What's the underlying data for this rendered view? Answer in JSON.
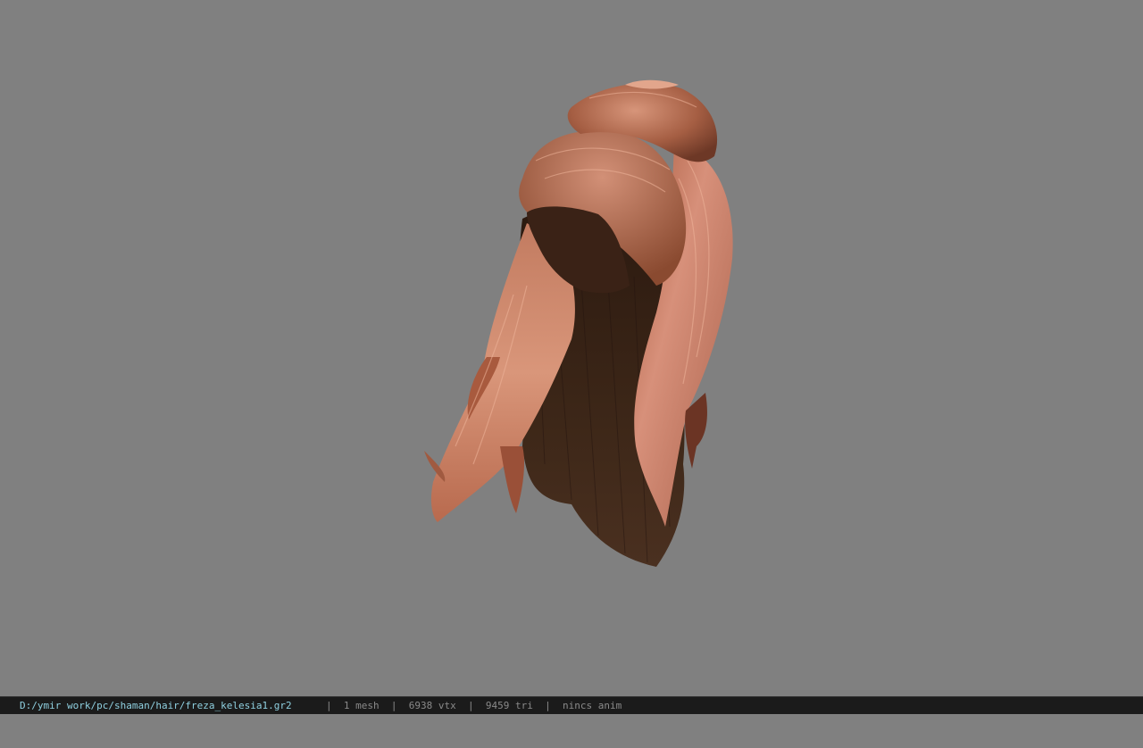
{
  "viewer": {
    "background_color": "#808080",
    "model_name": "freza_kelesia1",
    "model_colors": {
      "dark_base": "#3b2417",
      "mid": "#8a4a30",
      "light": "#d98f72",
      "highlight": "#f0b59a"
    }
  },
  "statusbar": {
    "file_path": "D:/ymir work/pc/shaman/hair/freza_kelesia1.gr2",
    "separator": "|",
    "mesh_count": "1 mesh",
    "vertex_count": "6938 vtx",
    "triangle_count": "9459 tri",
    "anim_status": "nincs anim"
  }
}
